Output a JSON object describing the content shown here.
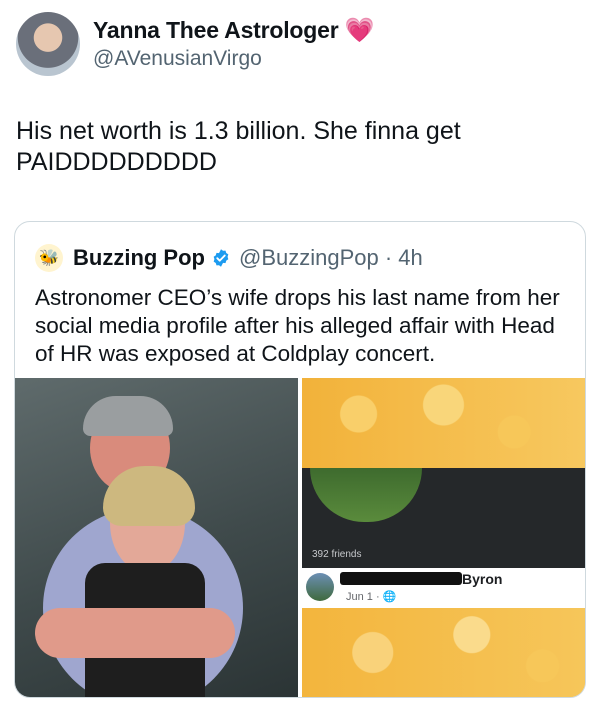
{
  "tweet": {
    "author": {
      "display_name": "Yanna Thee Astrologer",
      "handle": "@AVenusianVirgo",
      "badge_icon": "pink-heart-icon"
    },
    "text": "His net worth is 1.3 billion. She finna get PAIDDDDDDDDD"
  },
  "quote": {
    "author_name": "Buzzing Pop",
    "verified_icon": "verified-badge-icon",
    "handle_time": "@BuzzingPop · 4h",
    "text": "Astronomer CEO’s wife drops his last name from her social media profile after his alleged affair with Head of HR was exposed at Coldplay concert.",
    "media_right": {
      "friends_count": "392 friends",
      "post_name": "Byron",
      "post_date": "Jun 1 ·",
      "privacy_icon": "globe-icon"
    }
  },
  "colors": {
    "accent": "#1d9bf0",
    "honey": "#f4b73a",
    "text": "#0f1419",
    "muted": "#536471"
  }
}
